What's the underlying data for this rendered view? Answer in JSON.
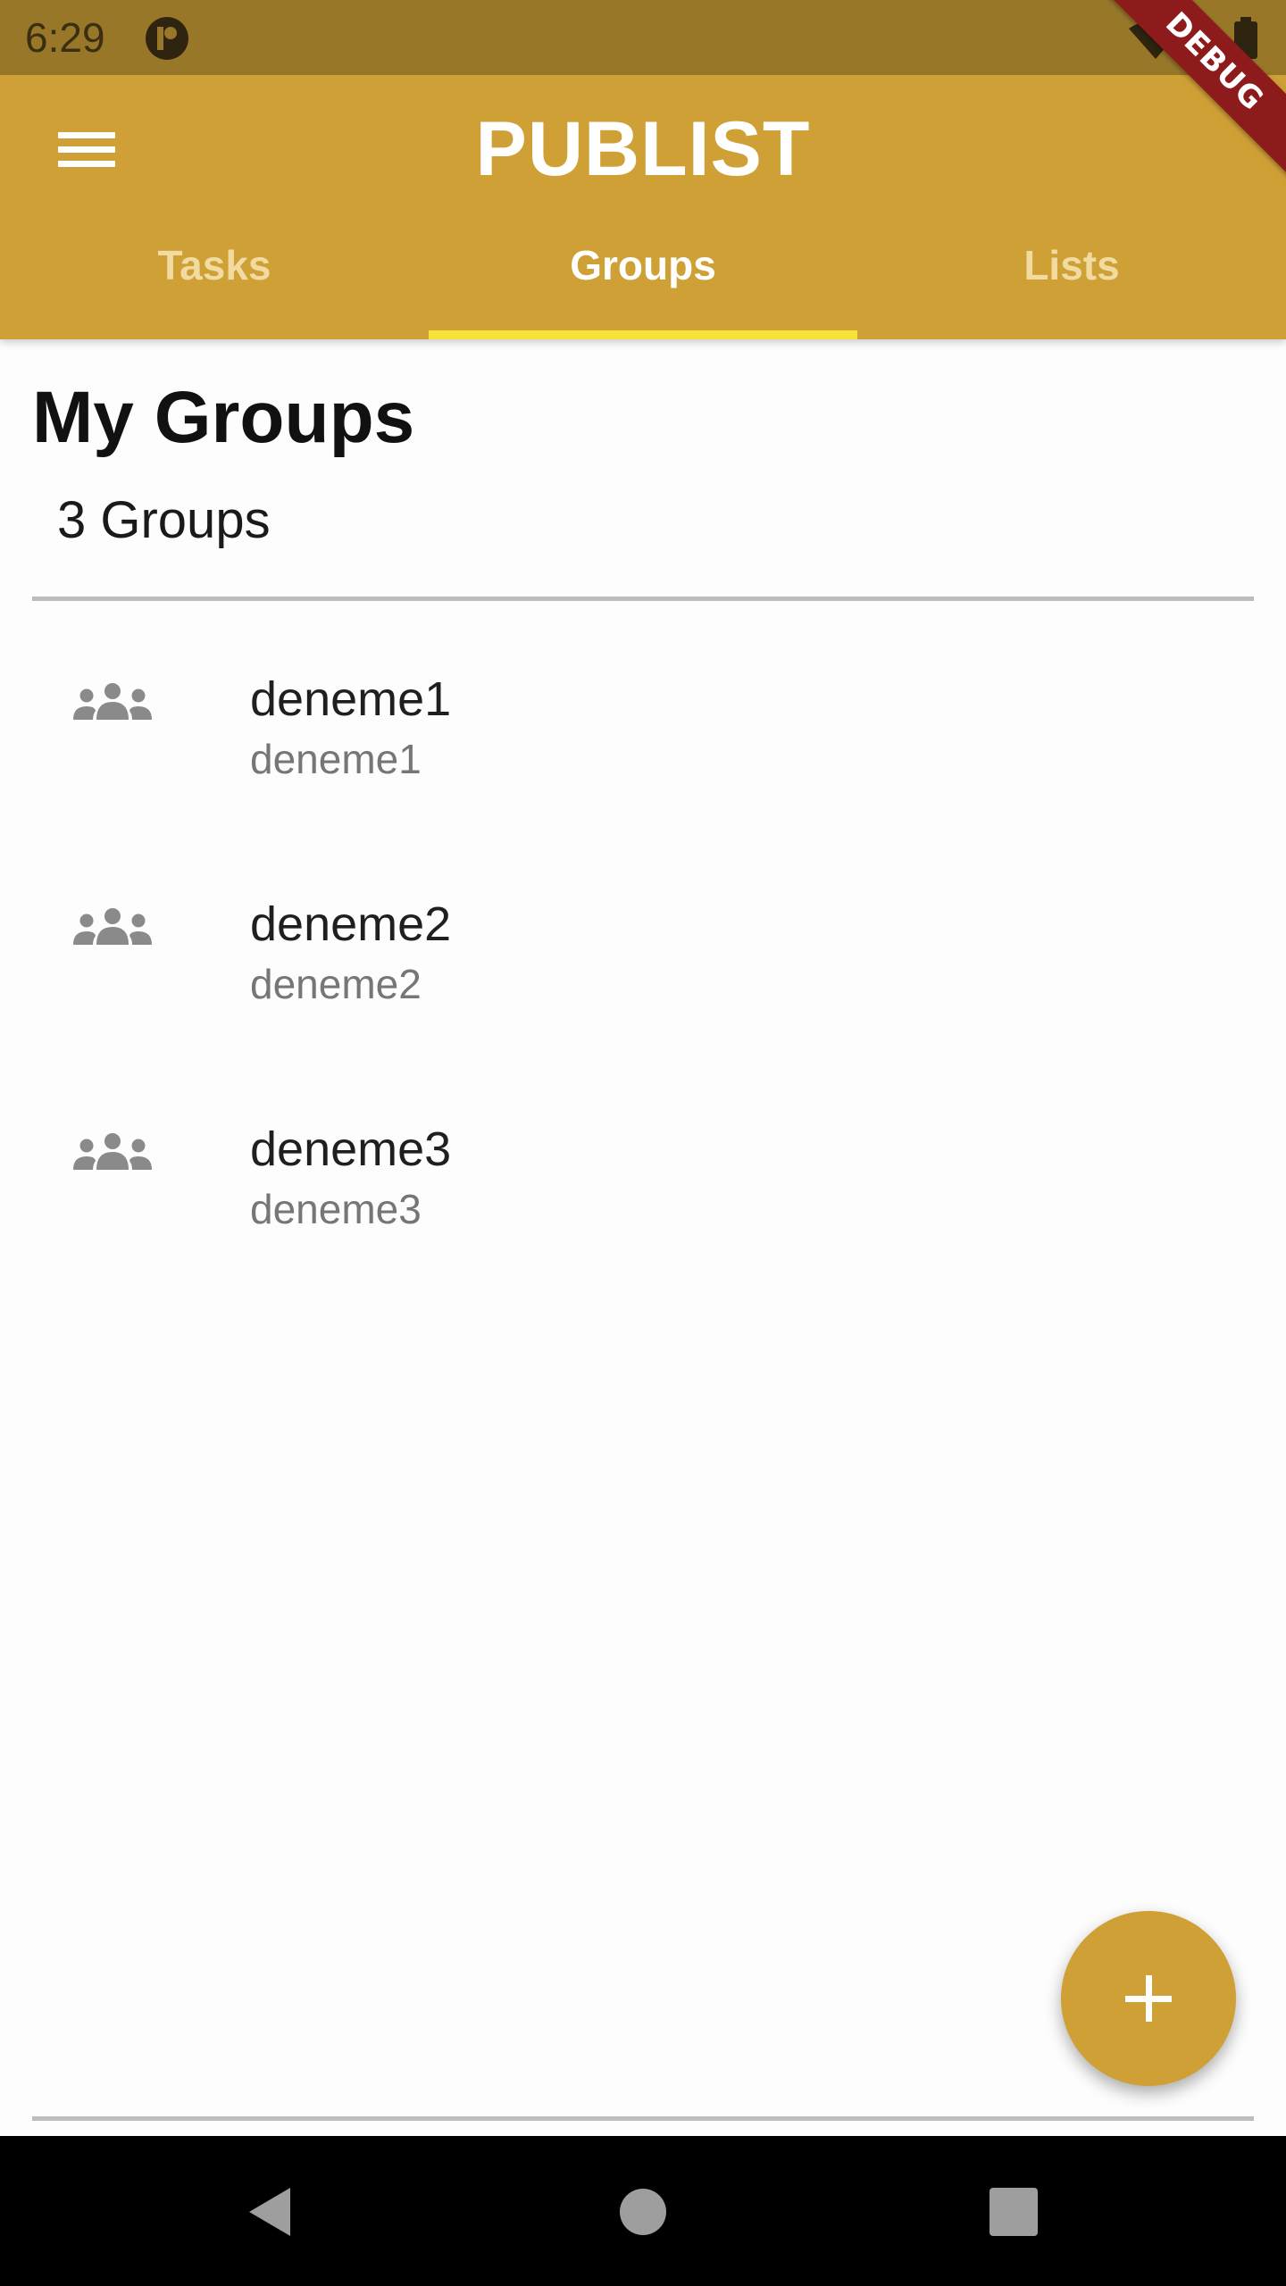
{
  "status_bar": {
    "time": "6:29",
    "debug_label": "DEBUG"
  },
  "app_bar": {
    "title": "PUBLIST",
    "tabs": [
      {
        "label": "Tasks",
        "active": false
      },
      {
        "label": "Groups",
        "active": true
      },
      {
        "label": "Lists",
        "active": false
      }
    ]
  },
  "content": {
    "title": "My Groups",
    "count_label": "3 Groups",
    "groups": [
      {
        "name": "deneme1",
        "subtitle": "deneme1",
        "icon": "group-icon"
      },
      {
        "name": "deneme2",
        "subtitle": "deneme2",
        "icon": "group-icon"
      },
      {
        "name": "deneme3",
        "subtitle": "deneme3",
        "icon": "group-icon"
      }
    ]
  },
  "fab": {
    "icon": "plus-icon"
  },
  "colors": {
    "primary": "#cfa035",
    "status_bar": "#987828",
    "tab_indicator": "#f7e23a",
    "debug_banner": "#8e1b1b"
  },
  "nav_bar": {
    "buttons": [
      "back-icon",
      "home-icon",
      "recents-icon"
    ]
  }
}
